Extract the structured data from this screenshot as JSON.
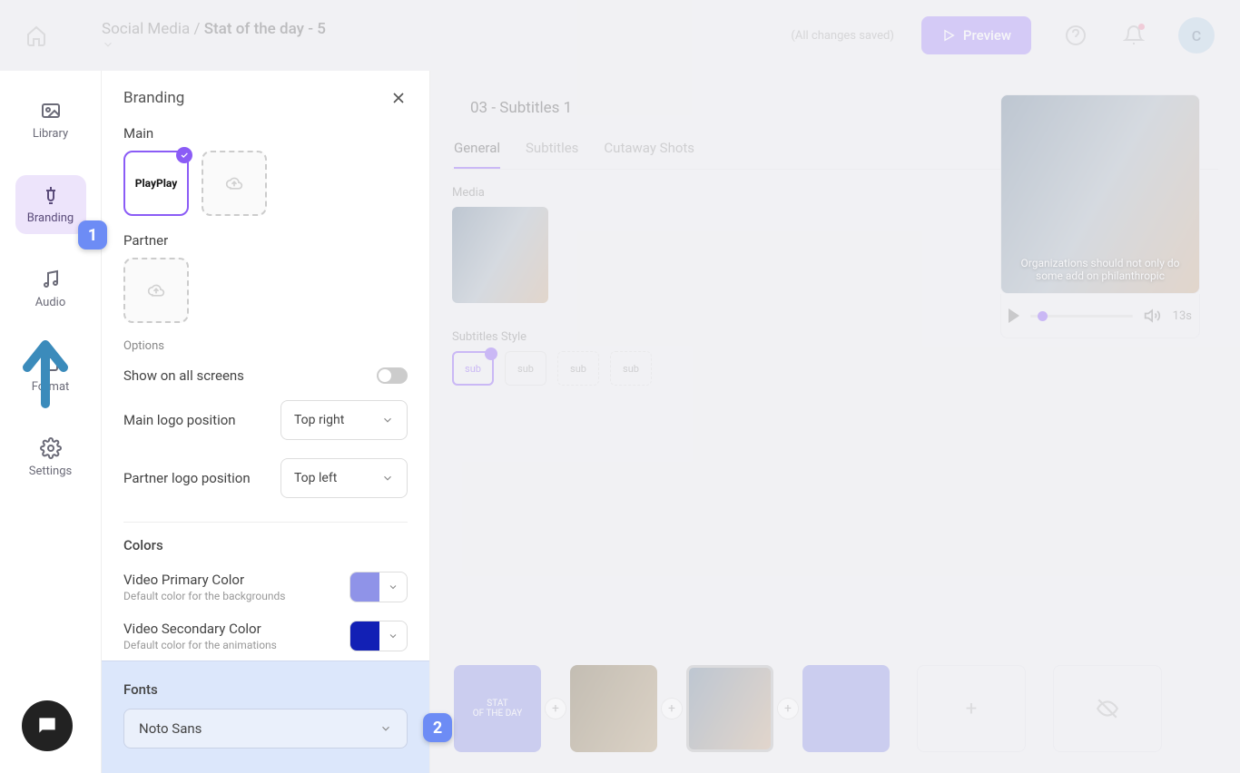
{
  "breadcrumb": {
    "folder": "Social Media",
    "name": "Stat of the day - 5"
  },
  "header": {
    "saved": "(All changes saved)",
    "preview": "Preview",
    "avatar": "C"
  },
  "nav": {
    "library": "Library",
    "branding": "Branding",
    "audio": "Audio",
    "format": "Format",
    "settings": "Settings"
  },
  "panel": {
    "title": "Branding",
    "main_label": "Main",
    "main_logo_text": "PlayPlay",
    "partner_label": "Partner",
    "options_label": "Options",
    "show_all": "Show on all screens",
    "main_pos_label": "Main logo position",
    "main_pos_value": "Top right",
    "partner_pos_label": "Partner logo position",
    "partner_pos_value": "Top left",
    "colors_label": "Colors",
    "primary_title": "Video Primary Color",
    "primary_sub": "Default color for the backgrounds",
    "primary_hex": "#8f93e8",
    "secondary_title": "Video Secondary Color",
    "secondary_sub": "Default color for the animations",
    "secondary_hex": "#1220b5",
    "fonts_label": "Fonts",
    "font_value": "Noto Sans"
  },
  "editor": {
    "slide_title": "03 - Subtitles 1",
    "tabs": {
      "general": "General",
      "subtitles": "Subtitles",
      "cutaway": "Cutaway Shots"
    },
    "media_label": "Media",
    "style_label": "Subtitles Style",
    "style_chip": "sub"
  },
  "preview": {
    "caption": "Organizations should not only do some add on philanthropic",
    "duration": "13s"
  },
  "timeline": {
    "t1": "STAT\nOF THE DAY",
    "t2": "",
    "t3": "",
    "t4": ""
  },
  "badges": {
    "b1": "1",
    "b2": "2"
  }
}
